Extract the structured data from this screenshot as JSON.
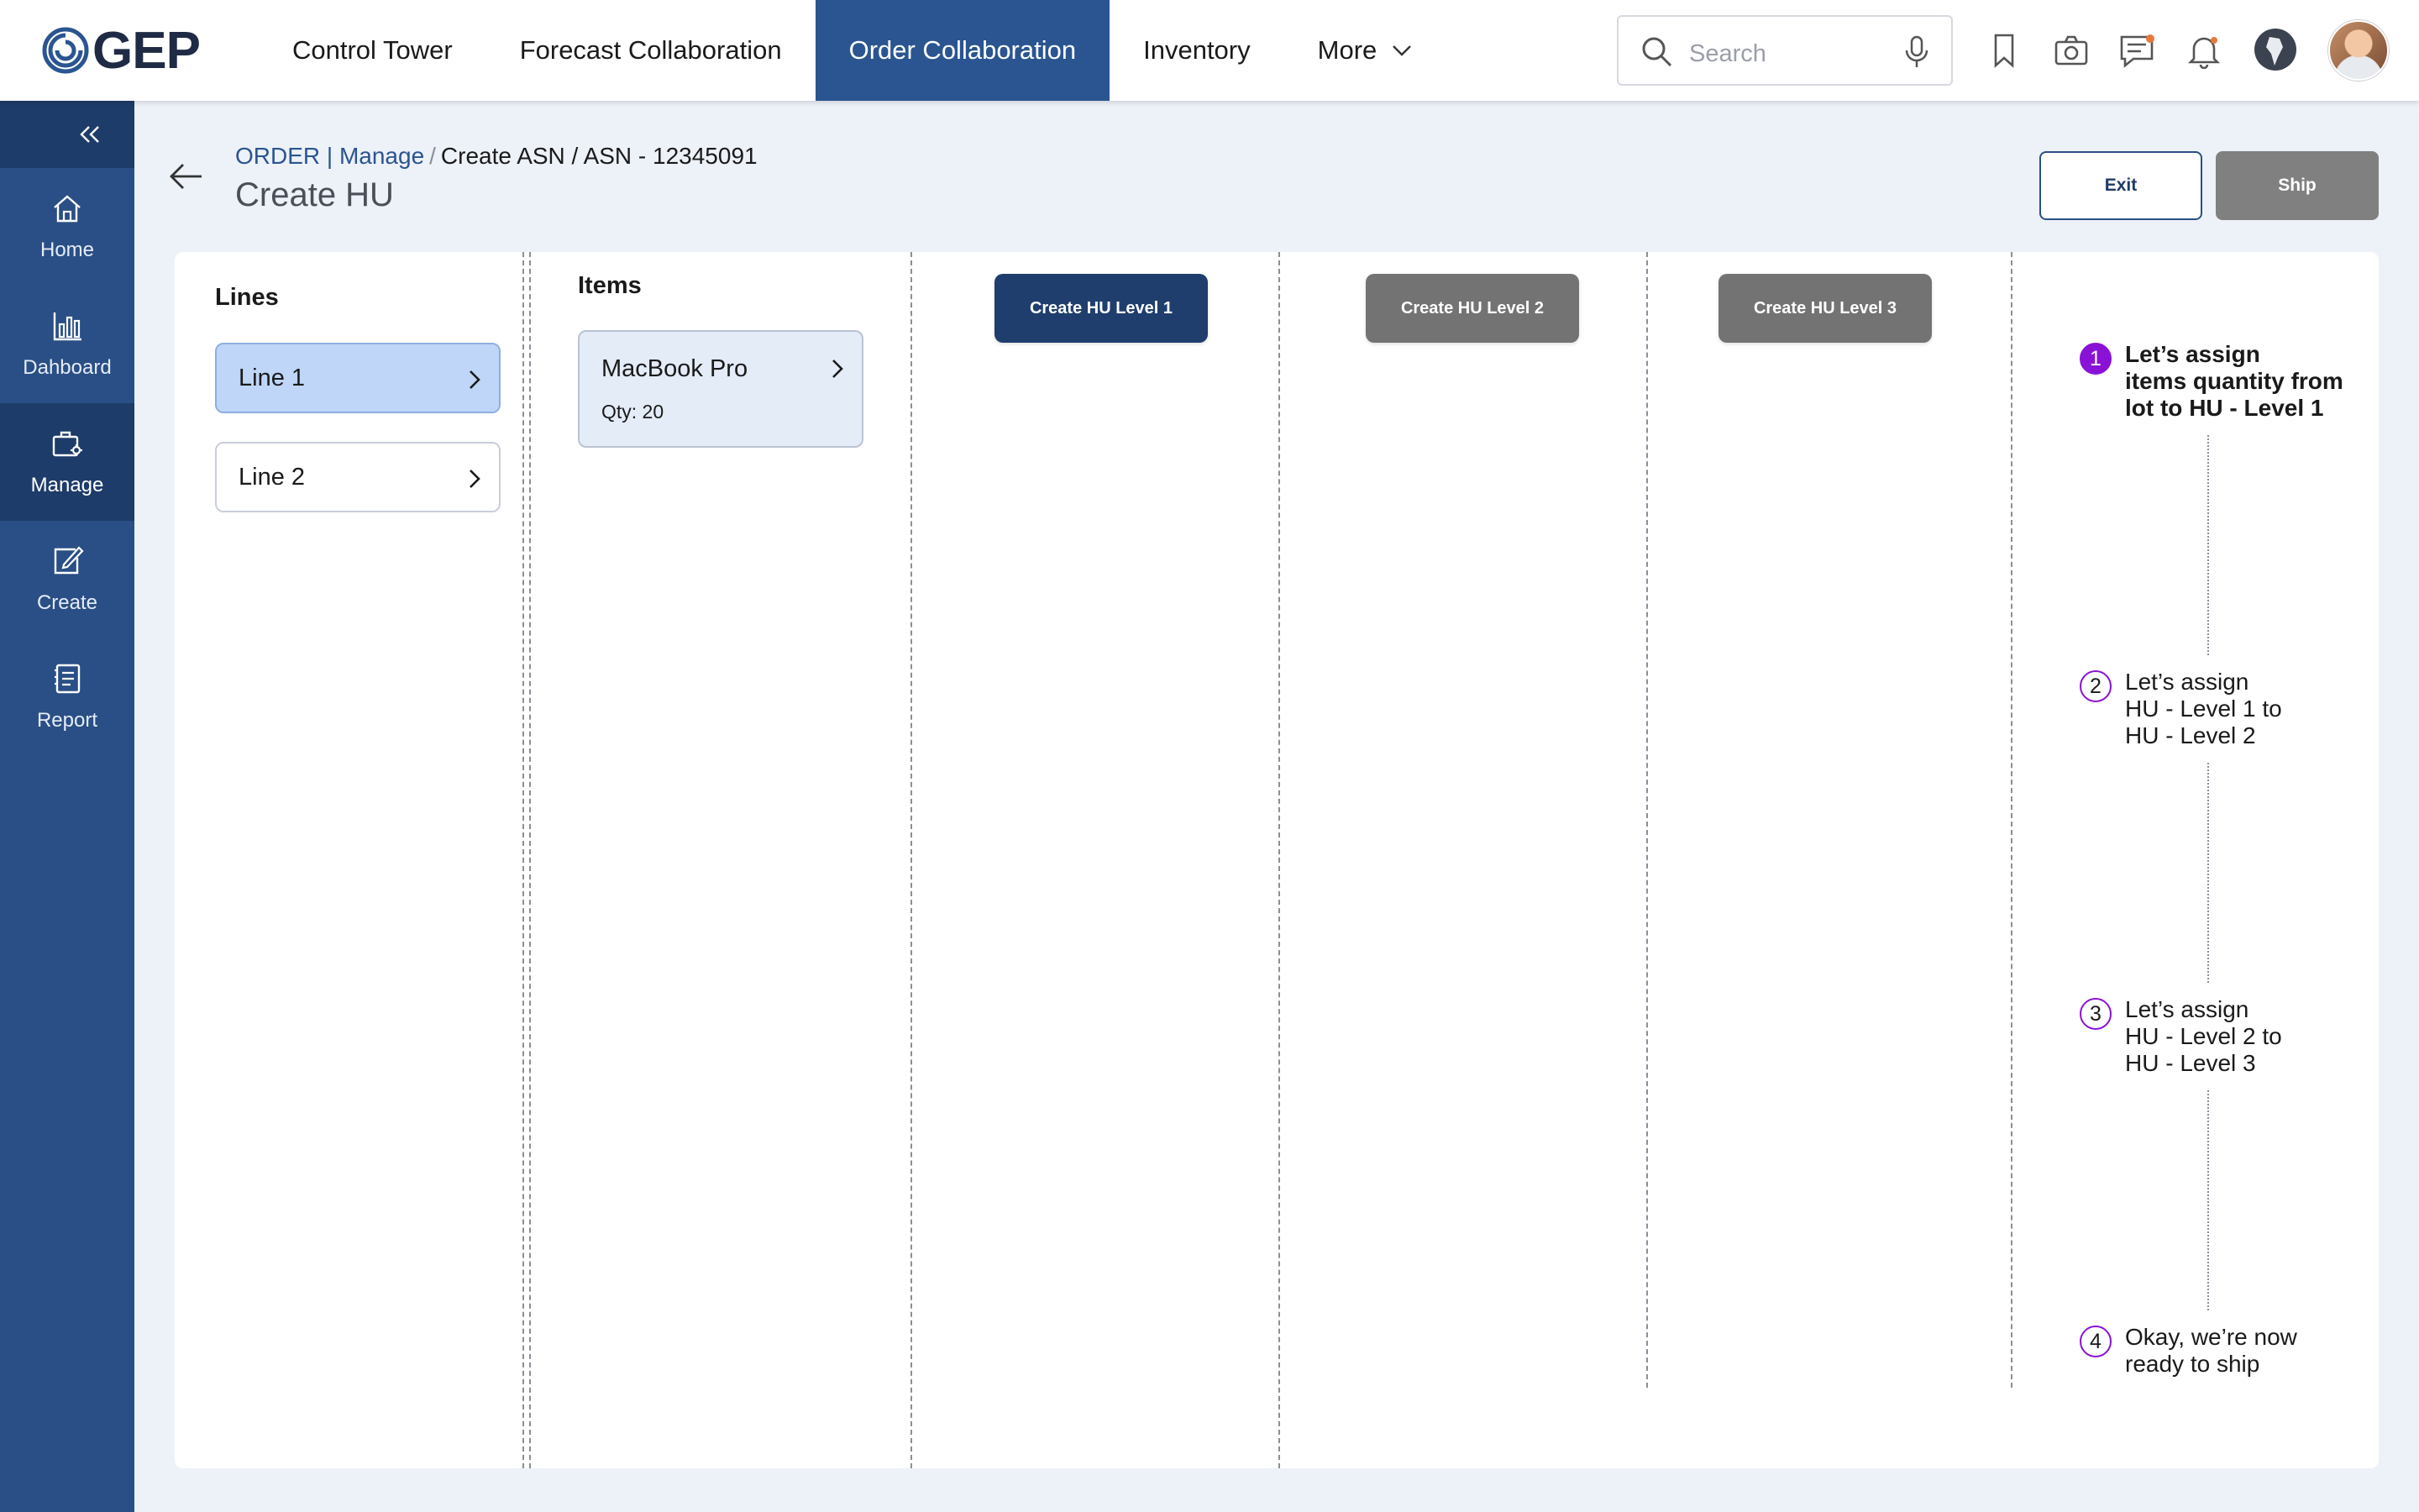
{
  "brand": {
    "logo_text": "GEP"
  },
  "nav": {
    "items": [
      {
        "label": "Control Tower"
      },
      {
        "label": "Forecast Collaboration"
      },
      {
        "label": "Order Collaboration"
      },
      {
        "label": "Inventory"
      },
      {
        "label": "More"
      }
    ],
    "active": "Order Collaboration"
  },
  "search": {
    "placeholder": "Search"
  },
  "top_icons": [
    "search-icon",
    "mic-icon",
    "bookmark-icon",
    "camera-icon",
    "chat-icon",
    "bell-icon",
    "globe-icon",
    "avatar"
  ],
  "sidebar": {
    "items": [
      {
        "label": "Home",
        "icon": "home-icon"
      },
      {
        "label": "Dahboard",
        "icon": "bar-chart-icon"
      },
      {
        "label": "Manage",
        "icon": "manage-icon"
      },
      {
        "label": "Create",
        "icon": "edit-icon"
      },
      {
        "label": "Report",
        "icon": "report-icon"
      }
    ],
    "active": "Manage"
  },
  "breadcrumb": {
    "root": "ORDER | Manage",
    "separator": "/",
    "path": "Create ASN / ASN - 12345091"
  },
  "page": {
    "title": "Create HU"
  },
  "actions": {
    "exit": "Exit",
    "ship": "Ship"
  },
  "lines": {
    "title": "Lines",
    "items": [
      {
        "label": "Line 1",
        "selected": true
      },
      {
        "label": "Line 2",
        "selected": false
      }
    ]
  },
  "items": {
    "title": "Items",
    "list": [
      {
        "name": "MacBook Pro",
        "qty": "Qty: 20"
      }
    ]
  },
  "hu_buttons": [
    {
      "label": "Create HU Level 1",
      "state": "active"
    },
    {
      "label": "Create HU Level 2",
      "state": "disabled"
    },
    {
      "label": "Create HU Level 3",
      "state": "disabled"
    }
  ],
  "steps": [
    {
      "num": "1",
      "lines": [
        "Let’s assign",
        "items quantity from",
        "lot to HU - Level 1"
      ],
      "current": true
    },
    {
      "num": "2",
      "lines": [
        "Let’s assign",
        "HU - Level 1 to",
        "HU - Level 2"
      ],
      "current": false
    },
    {
      "num": "3",
      "lines": [
        "Let’s assign",
        "HU - Level 2 to",
        "HU - Level 3"
      ],
      "current": false
    },
    {
      "num": "4",
      "lines": [
        "Okay, we’re now",
        "ready to ship"
      ],
      "current": false
    }
  ],
  "colors": {
    "nav_active": "#2a5591",
    "sidebar": "#2a4f86",
    "sidebar_active": "#1e3c6a",
    "primary_button": "#1f3e6d",
    "disabled_button": "#737373",
    "step_accent": "#8a12d6",
    "line_selected": "#bfd6f8"
  }
}
